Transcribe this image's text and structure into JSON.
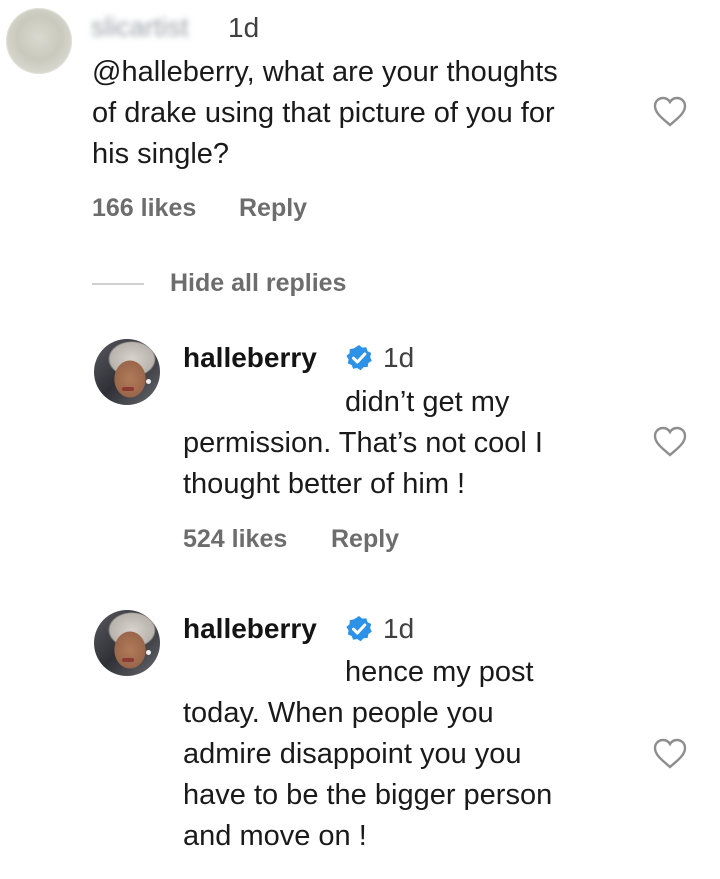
{
  "comments": [
    {
      "username": "slicartist",
      "time": "1d",
      "lines": [
        "@halleberry, what are your thoughts",
        "of drake using that picture of you for",
        "his single?"
      ],
      "likes": "166 likes",
      "reply": "Reply"
    }
  ],
  "hide_replies": "Hide all replies",
  "replies": [
    {
      "username": "halleberry",
      "time": "1d",
      "lines": [
        "didn’t get my",
        "permission. That’s not cool I",
        "thought better of him !"
      ],
      "likes": "524 likes",
      "reply": "Reply"
    },
    {
      "username": "halleberry",
      "time": "1d",
      "lines": [
        "hence my post",
        "today. When people you",
        "admire disappoint you you",
        "have to be the bigger person",
        "and move on !"
      ]
    }
  ],
  "icons": {
    "like": "heart-outline-icon",
    "verified": "verified-badge-icon"
  },
  "colors": {
    "verified": "#2b92e8",
    "meta": "#6d6d6d",
    "text": "#1a1a1a"
  }
}
